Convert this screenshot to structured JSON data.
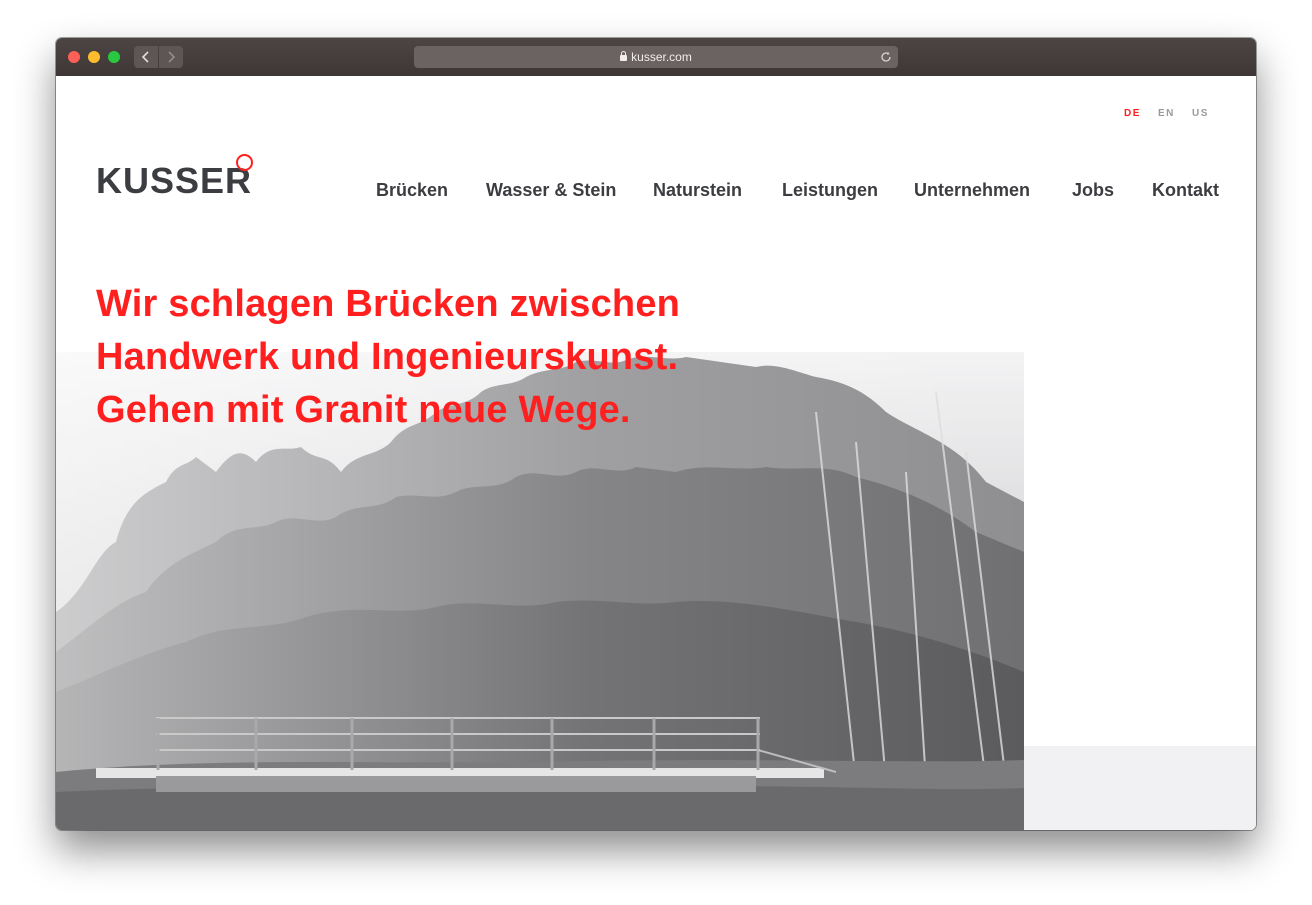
{
  "browser": {
    "url": "kusser.com",
    "back_icon": "chevron-left-icon",
    "forward_icon": "chevron-right-icon",
    "reload_icon": "reload-icon"
  },
  "languages": {
    "items": [
      "DE",
      "EN",
      "US"
    ],
    "active": "DE"
  },
  "brand": {
    "name": "KUSSER",
    "accent_color": "#ff1f1f",
    "text_color": "#3c3d41"
  },
  "nav": {
    "items": [
      "Brücken",
      "Wasser & Stein",
      "Naturstein",
      "Leistungen",
      "Unternehmen",
      "Jobs",
      "Kontakt"
    ]
  },
  "hero": {
    "headline": [
      "Wir schlagen Brücken zwischen",
      "Handwerk und Ingenieurskunst.",
      "Gehen mit Granit neue Wege."
    ]
  }
}
